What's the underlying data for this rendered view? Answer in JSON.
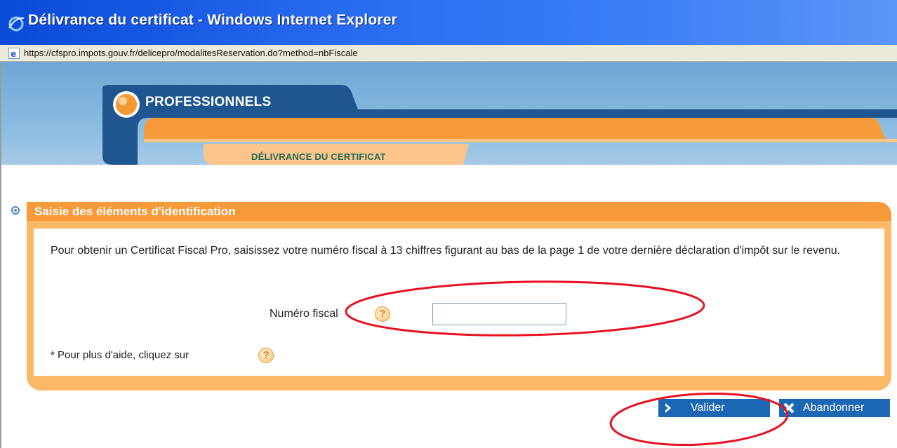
{
  "window": {
    "title": "Délivrance du certificat - Windows Internet Explorer",
    "url": "https://cfspro.impots.gouv.fr/delicepro/modalitesReservation.do?method=nbFiscale"
  },
  "banner": {
    "title": "PROFESSIONNELS",
    "subtitle": "DÉLIVRANCE DU CERTIFICAT"
  },
  "section": {
    "title": "Saisie des éléments d'identification",
    "intro": "Pour obtenir un Certificat Fiscal Pro, saisissez votre numéro fiscal à 13 chiffres figurant au bas de la page 1 de votre dernière déclaration d'impôt sur le revenu.",
    "field_label": "Numéro fiscal",
    "field_value": "",
    "help_icon_glyph": "?",
    "help_text": "* Pour plus d'aide, cliquez sur"
  },
  "buttons": {
    "validate": "Valider",
    "abandon": "Abandonner"
  },
  "colors": {
    "orange": "#f79a3a",
    "blue_button": "#1c67b4",
    "annotation_red": "#e8101e"
  }
}
